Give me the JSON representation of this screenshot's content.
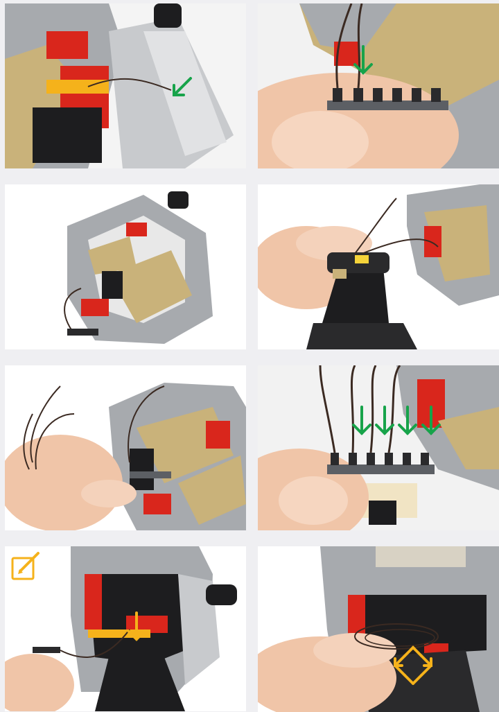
{
  "page": {
    "background": "#efeff2"
  },
  "colors": {
    "arrow_green": "#17a34a",
    "arrow_orange": "#f5b21b",
    "lego_red": "#d9261c",
    "lego_gray": "#a7aaae",
    "lego_tan": "#c9b27a",
    "lego_black": "#1d1d1f",
    "skin": "#f0c5a8"
  },
  "steps": [
    {
      "id": 1,
      "markers": [
        {
          "type": "arrow",
          "direction": "down-left",
          "color": "green"
        }
      ]
    },
    {
      "id": 2,
      "markers": [
        {
          "type": "arrow",
          "direction": "down",
          "color": "green"
        }
      ]
    },
    {
      "id": 3,
      "markers": []
    },
    {
      "id": 4,
      "markers": []
    },
    {
      "id": 5,
      "markers": []
    },
    {
      "id": 6,
      "markers": [
        {
          "type": "arrow",
          "direction": "down",
          "color": "green",
          "count": 4
        }
      ]
    },
    {
      "id": 7,
      "markers": [
        {
          "type": "edit-icon",
          "color": "orange"
        },
        {
          "type": "arrow",
          "direction": "down",
          "color": "orange"
        }
      ]
    },
    {
      "id": 8,
      "markers": [
        {
          "type": "expand-arrows-icon",
          "color": "orange"
        }
      ]
    }
  ]
}
